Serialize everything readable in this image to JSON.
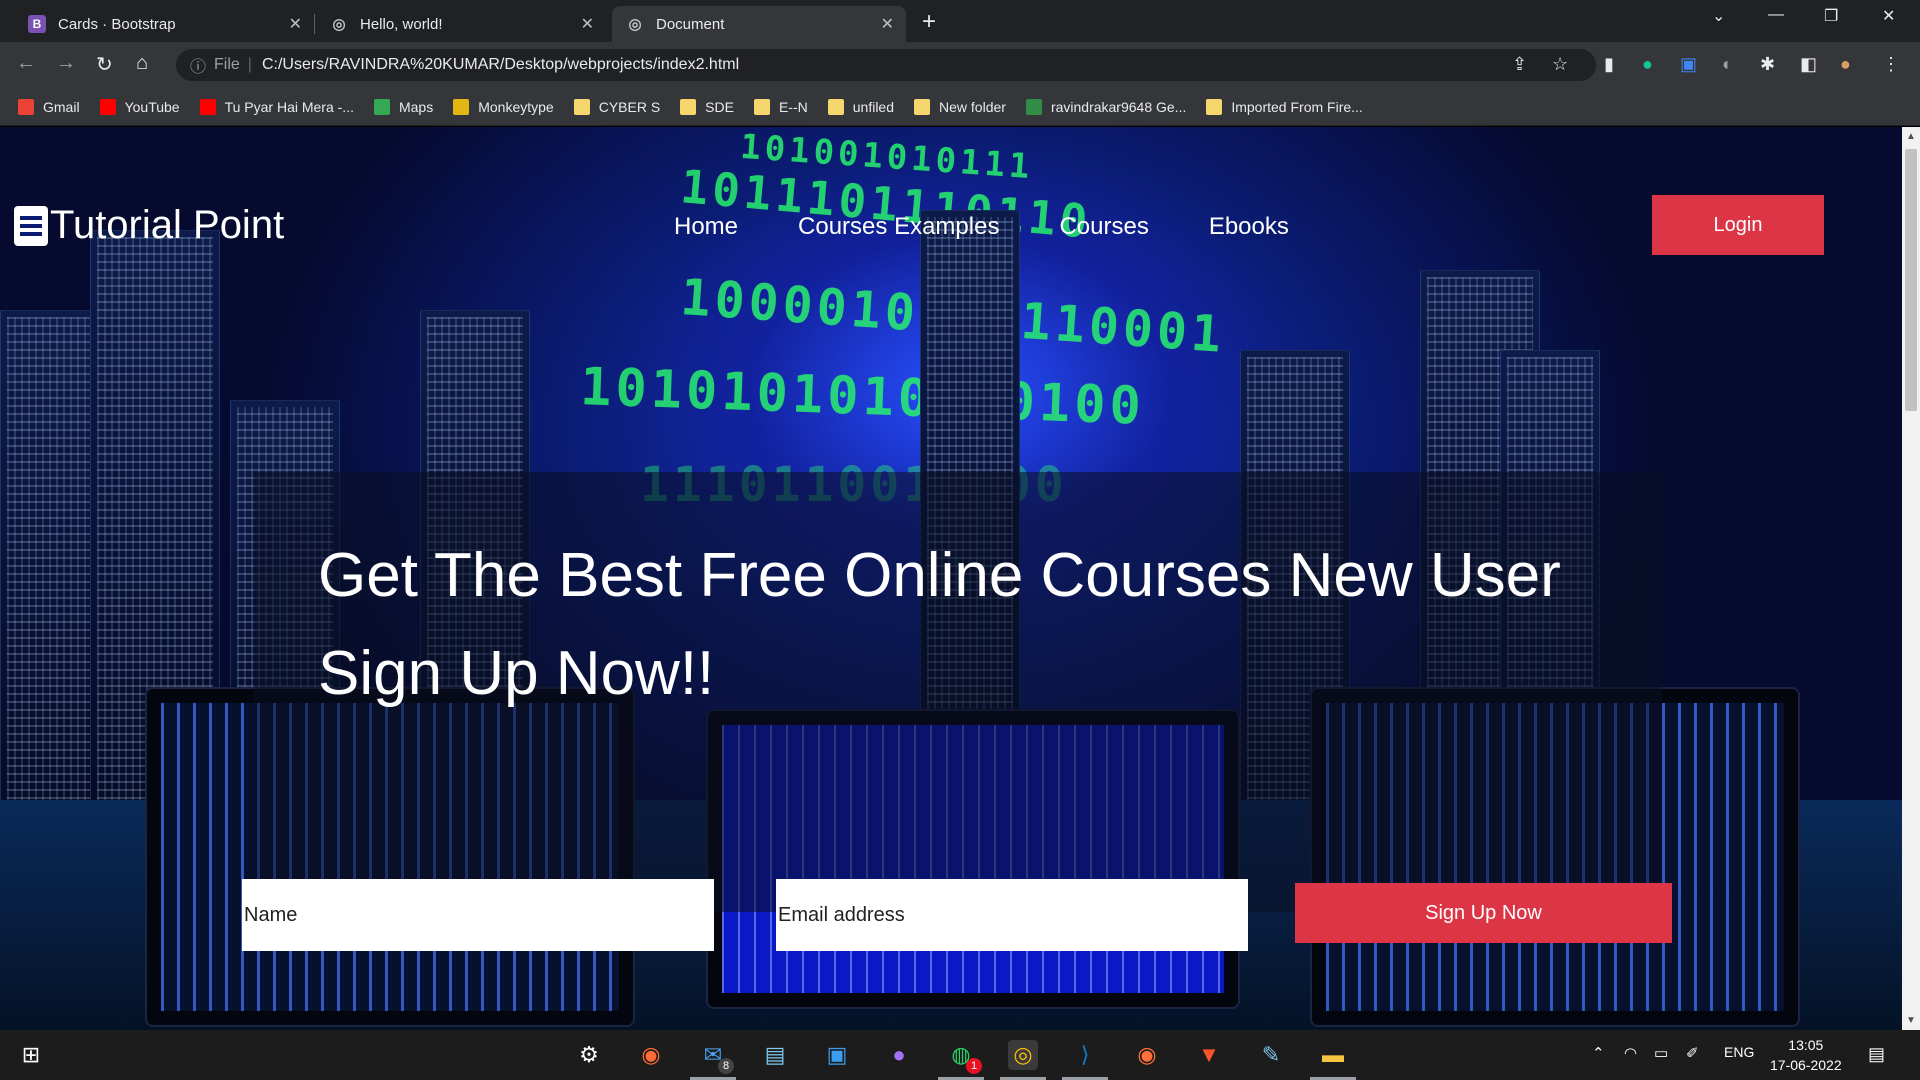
{
  "browser": {
    "tabs": [
      {
        "title": "Cards · Bootstrap",
        "icon": "bootstrap-icon",
        "active": false
      },
      {
        "title": "Hello, world!",
        "icon": "globe-icon",
        "active": false
      },
      {
        "title": "Document",
        "icon": "globe-icon",
        "active": true
      }
    ],
    "omnibox": {
      "scheme_label": "File",
      "url": "C:/Users/RAVINDRA%20KUMAR/Desktop/webprojects/index2.html"
    },
    "bookmarks": [
      {
        "label": "Gmail",
        "icon": "gmail-icon",
        "color": "#ea4335"
      },
      {
        "label": "YouTube",
        "icon": "youtube-icon",
        "color": "#ff0000"
      },
      {
        "label": "Tu Pyar Hai Mera -...",
        "icon": "music-icon",
        "color": "#ff0000"
      },
      {
        "label": "Maps",
        "icon": "maps-icon",
        "color": "#34a853"
      },
      {
        "label": "Monkeytype",
        "icon": "monkeytype-icon",
        "color": "#e2b714"
      },
      {
        "label": "CYBER S",
        "icon": "folder-icon",
        "color": "#f5d76e"
      },
      {
        "label": "SDE",
        "icon": "folder-icon",
        "color": "#f5d76e"
      },
      {
        "label": "E--N",
        "icon": "folder-icon",
        "color": "#f5d76e"
      },
      {
        "label": "unfiled",
        "icon": "folder-icon",
        "color": "#f5d76e"
      },
      {
        "label": "New folder",
        "icon": "folder-icon",
        "color": "#f5d76e"
      },
      {
        "label": "ravindrakar9648 Ge...",
        "icon": "gfg-icon",
        "color": "#2f8d46"
      },
      {
        "label": "Imported From Fire...",
        "icon": "folder-icon",
        "color": "#f5d76e"
      }
    ]
  },
  "site": {
    "brand": "Tutorial Point",
    "nav": [
      "Home",
      "Courses Examples",
      "Courses",
      "Ebooks"
    ],
    "login_label": "Login",
    "hero_title": "Get The Best Free Online Courses New User Sign Up Now!!",
    "name_placeholder": "Name",
    "email_placeholder": "Email address",
    "signup_label": "Sign Up Now",
    "accent_color": "#dc3545",
    "background_binary": [
      "101001010111",
      "1011101110110",
      "1000010111110001",
      "1010101010100100",
      "1110110010000"
    ]
  },
  "taskbar": {
    "mail_badge": "8",
    "whatsapp_badge": "1",
    "language": "ENG",
    "time": "13:05",
    "date": "17-06-2022"
  }
}
